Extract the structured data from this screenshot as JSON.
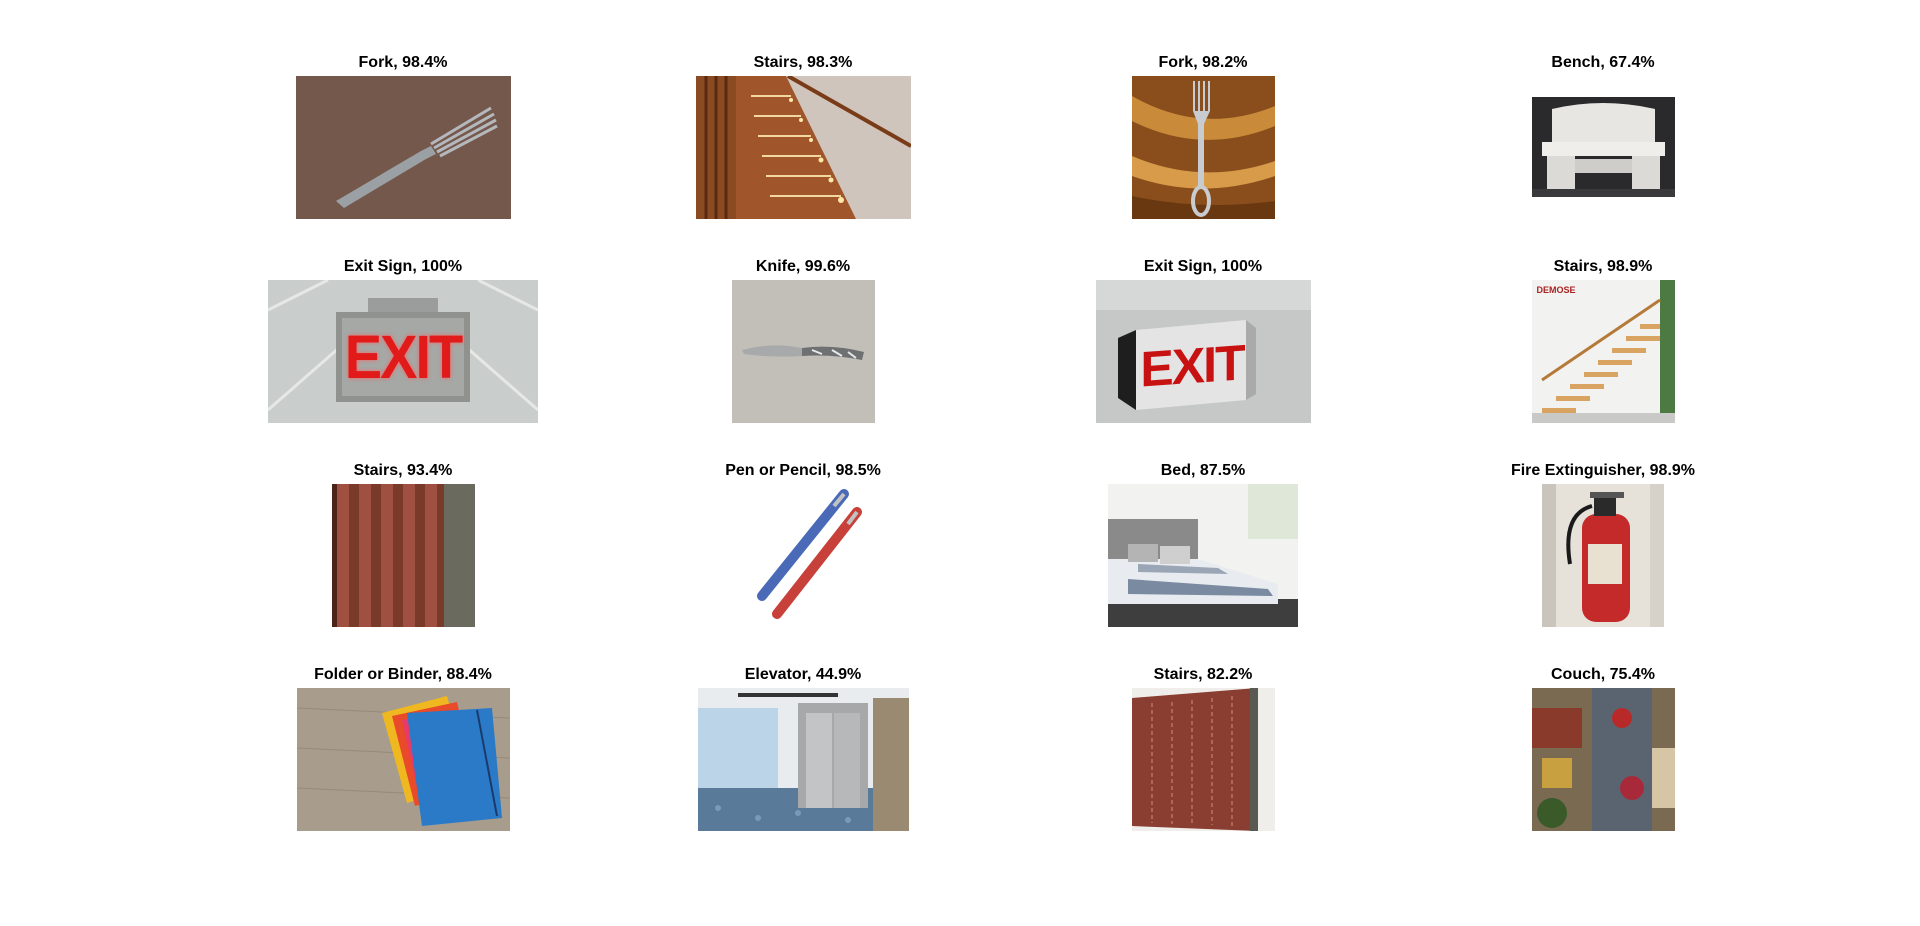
{
  "figure": {
    "tiles": [
      {
        "label": "Fork, 98.4%",
        "image": "fork-photo"
      },
      {
        "label": "Stairs, 98.3%",
        "image": "stairs-photo"
      },
      {
        "label": "Fork, 98.2%",
        "image": "fork-photo"
      },
      {
        "label": "Bench, 67.4%",
        "image": "bench-photo"
      },
      {
        "label": "Exit Sign, 100%",
        "image": "exit-sign-photo",
        "sign_text": "EXIT"
      },
      {
        "label": "Knife, 99.6%",
        "image": "knife-photo"
      },
      {
        "label": "Exit Sign, 100%",
        "image": "exit-sign-photo",
        "sign_text": "EXIT"
      },
      {
        "label": "Stairs, 98.9%",
        "image": "stairs-photo",
        "logo_text": "DEMOSE"
      },
      {
        "label": "Stairs, 93.4%",
        "image": "brick-wall-photo"
      },
      {
        "label": "Pen or Pencil, 98.5%",
        "image": "pens-photo"
      },
      {
        "label": "Bed, 87.5%",
        "image": "bed-photo"
      },
      {
        "label": "Fire Extinguisher, 98.9%",
        "image": "fire-extinguisher-photo"
      },
      {
        "label": "Folder or Binder, 88.4%",
        "image": "folders-photo"
      },
      {
        "label": "Elevator, 44.9%",
        "image": "elevator-photo"
      },
      {
        "label": "Stairs, 82.2%",
        "image": "patterned-wall-photo"
      },
      {
        "label": "Couch, 75.4%",
        "image": "living-room-photo"
      }
    ]
  }
}
